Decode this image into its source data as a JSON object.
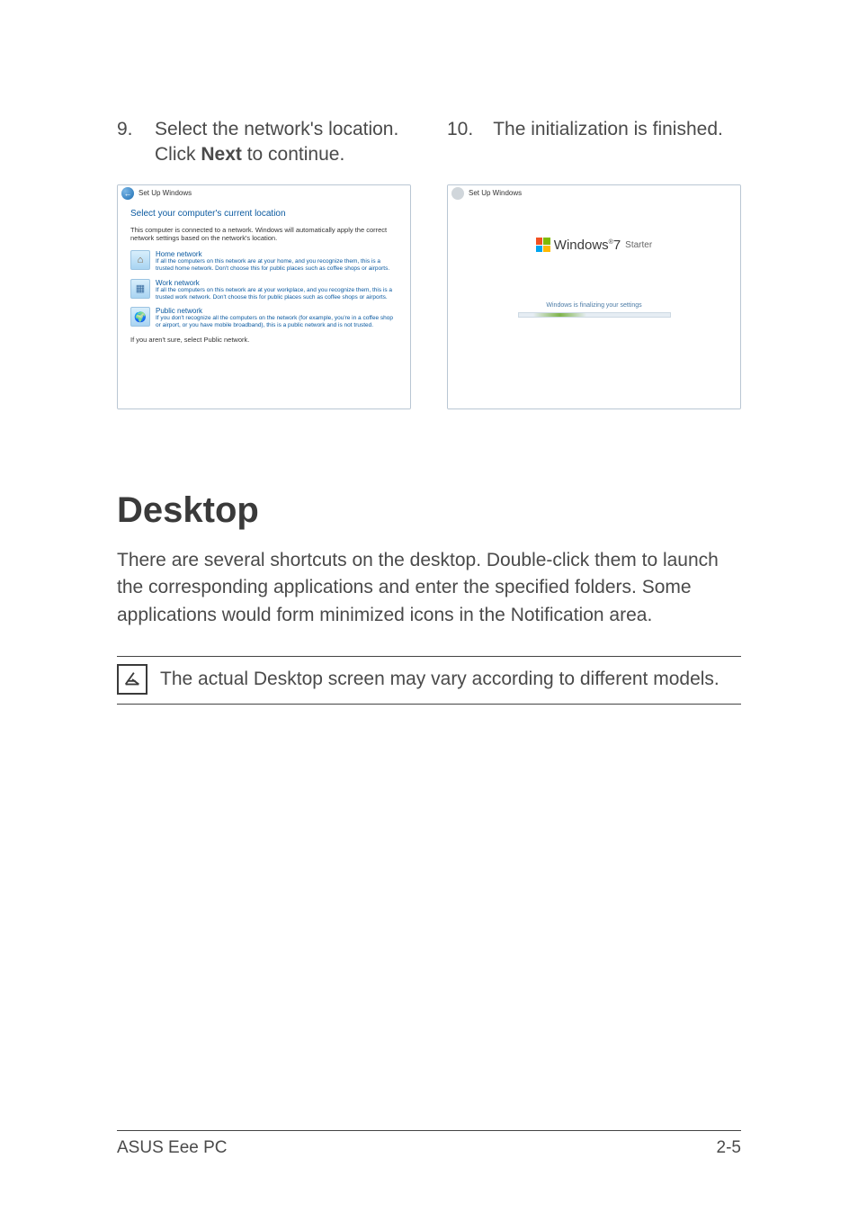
{
  "steps": {
    "step9": {
      "num": "9.",
      "line1": "Select the network's location.",
      "line2_pre": "Click ",
      "line2_bold": "Next",
      "line2_post": " to continue."
    },
    "step10": {
      "num": "10.",
      "text": "The initialization is finished."
    }
  },
  "shot1": {
    "title_prefix": "Set Up Windows",
    "heading": "Select your computer's current location",
    "subtext": "This computer is connected to a network. Windows will automatically apply the correct network settings based on the network's location.",
    "home": {
      "title": "Home network",
      "desc": "If all the computers on this network are at your home, and you recognize them, this is a trusted home network.  Don't choose this for public places such as coffee shops or airports."
    },
    "work": {
      "title": "Work network",
      "desc": "If all the computers on this network are at your workplace, and you recognize them, this is a trusted work network. Don't choose this for public places such as coffee shops or airports."
    },
    "public": {
      "title": "Public network",
      "desc": "If you don't recognize all the computers on the network (for example, you're in a coffee shop or airport, or you have mobile broadband), this is a public network and is not trusted."
    },
    "footer": "If you aren't sure, select Public network."
  },
  "shot2": {
    "title_prefix": "Set Up Windows",
    "brand": "Windows",
    "ver": "7",
    "edition": "Starter",
    "status": "Windows is finalizing your settings"
  },
  "section": {
    "heading": "Desktop",
    "para": "There are several shortcuts on the desktop. Double-click them to launch the corresponding applications and enter the specified folders. Some applications would form minimized icons in the Notification area.",
    "note": "The actual Desktop screen may vary according to different models."
  },
  "footer": {
    "left": "ASUS Eee PC",
    "right": "2-5"
  }
}
